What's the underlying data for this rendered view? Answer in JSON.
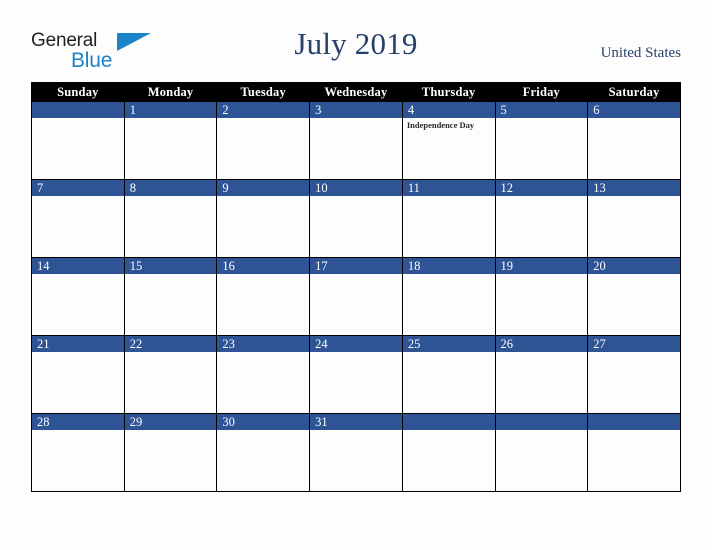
{
  "brand": {
    "name_part1": "General",
    "name_part2": "Blue",
    "accent_color": "#1d83c8"
  },
  "header": {
    "title": "July 2019",
    "country": "United States",
    "title_color": "#27416b"
  },
  "calendar": {
    "weekday_headers": [
      "Sunday",
      "Monday",
      "Tuesday",
      "Wednesday",
      "Thursday",
      "Friday",
      "Saturday"
    ],
    "header_bg": "#000000",
    "daynum_bg": "#2f5496",
    "weeks": [
      [
        {
          "day": "",
          "event": ""
        },
        {
          "day": "1",
          "event": ""
        },
        {
          "day": "2",
          "event": ""
        },
        {
          "day": "3",
          "event": ""
        },
        {
          "day": "4",
          "event": "Independence Day"
        },
        {
          "day": "5",
          "event": ""
        },
        {
          "day": "6",
          "event": ""
        }
      ],
      [
        {
          "day": "7",
          "event": ""
        },
        {
          "day": "8",
          "event": ""
        },
        {
          "day": "9",
          "event": ""
        },
        {
          "day": "10",
          "event": ""
        },
        {
          "day": "11",
          "event": ""
        },
        {
          "day": "12",
          "event": ""
        },
        {
          "day": "13",
          "event": ""
        }
      ],
      [
        {
          "day": "14",
          "event": ""
        },
        {
          "day": "15",
          "event": ""
        },
        {
          "day": "16",
          "event": ""
        },
        {
          "day": "17",
          "event": ""
        },
        {
          "day": "18",
          "event": ""
        },
        {
          "day": "19",
          "event": ""
        },
        {
          "day": "20",
          "event": ""
        }
      ],
      [
        {
          "day": "21",
          "event": ""
        },
        {
          "day": "22",
          "event": ""
        },
        {
          "day": "23",
          "event": ""
        },
        {
          "day": "24",
          "event": ""
        },
        {
          "day": "25",
          "event": ""
        },
        {
          "day": "26",
          "event": ""
        },
        {
          "day": "27",
          "event": ""
        }
      ],
      [
        {
          "day": "28",
          "event": ""
        },
        {
          "day": "29",
          "event": ""
        },
        {
          "day": "30",
          "event": ""
        },
        {
          "day": "31",
          "event": ""
        },
        {
          "day": "",
          "event": ""
        },
        {
          "day": "",
          "event": ""
        },
        {
          "day": "",
          "event": ""
        }
      ]
    ]
  }
}
